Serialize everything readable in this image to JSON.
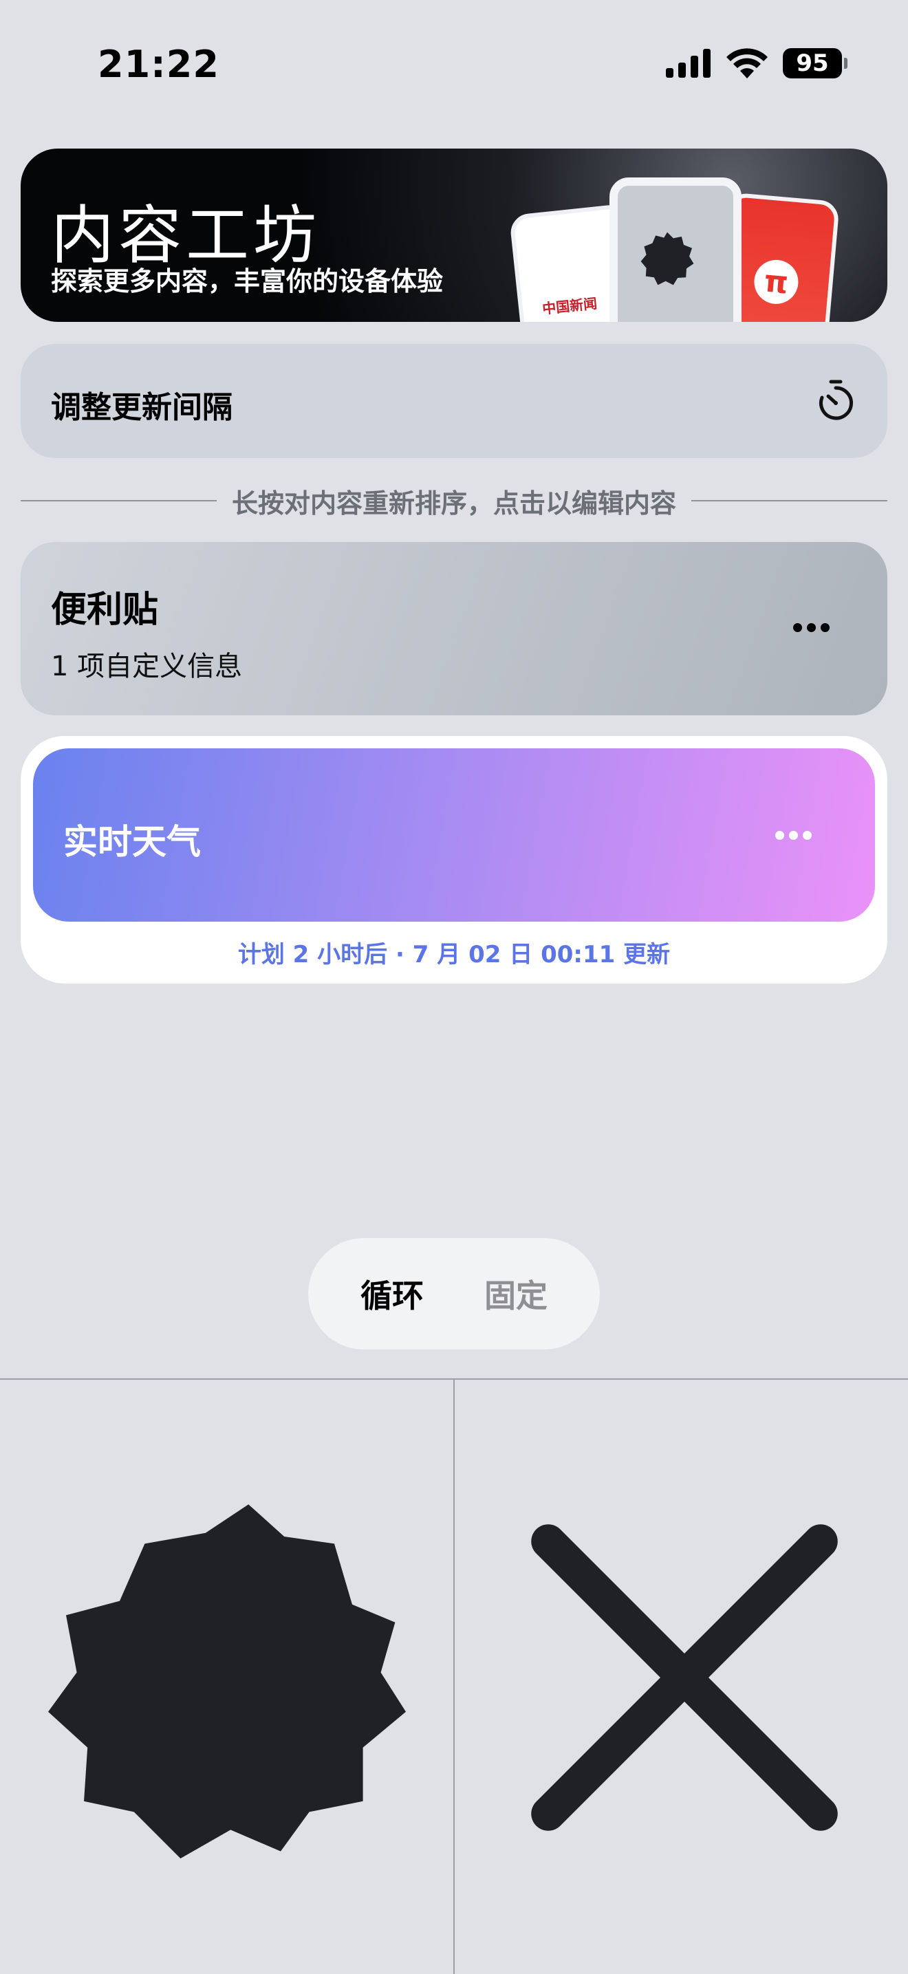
{
  "status_bar": {
    "time": "21:22",
    "battery": "95"
  },
  "hero": {
    "title": "内容工坊",
    "subtitle": "探索更多内容，丰富你的设备体验",
    "card_brand_text": "中国新闻",
    "card_symbol": "π"
  },
  "interval": {
    "label": "调整更新间隔",
    "icon": "timer-icon"
  },
  "divider": {
    "text": "长按对内容重新排序，点击以编辑内容"
  },
  "items": [
    {
      "title": "便利贴",
      "subtitle": "1 项自定义信息",
      "icon": "more-icon"
    },
    {
      "title": "实时天气",
      "note": "计划 2 小时后 · 7 月 02 日 00:11 更新",
      "icon": "more-icon"
    }
  ],
  "segment": {
    "options": [
      "循环",
      "固定"
    ],
    "selected": "循环"
  },
  "bottom_panel": {
    "left_icon": "badge-shape-icon",
    "right_icon": "close-x-icon"
  },
  "colors": {
    "background": "#dfe1e6",
    "weather_gradient_start": "#6a82ee",
    "weather_gradient_end": "#ea92f8",
    "note_blue": "#5b74e6",
    "accent_red": "#e8342c"
  }
}
